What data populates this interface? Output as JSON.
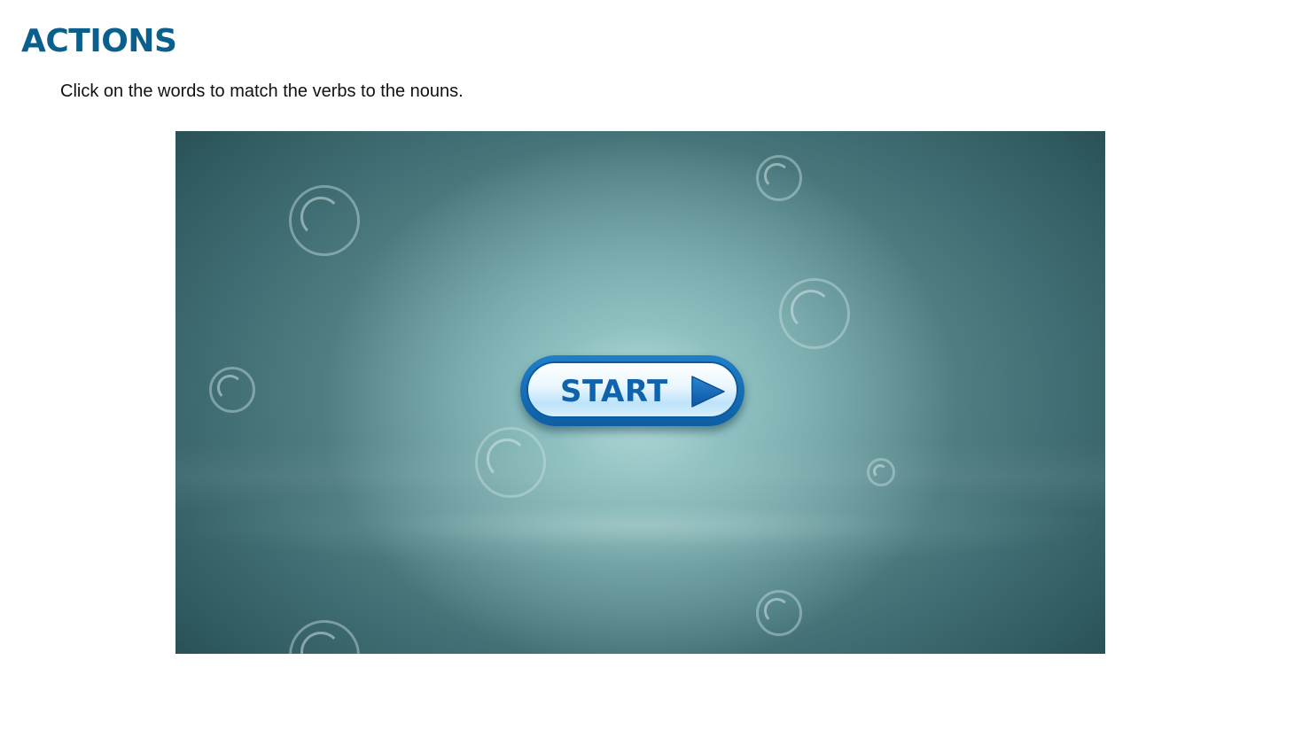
{
  "header": {
    "title": "ACTIONS",
    "instructions": "Click on the words to match the verbs to the nouns."
  },
  "game": {
    "start_label": "START",
    "start_icon": "play-arrow-icon",
    "colors": {
      "title": "#0a5f8c",
      "button_text": "#0f63ad",
      "button_border": "#0e5ea3",
      "stage_center": "#b9dedc",
      "stage_edge": "#1c3538"
    }
  }
}
